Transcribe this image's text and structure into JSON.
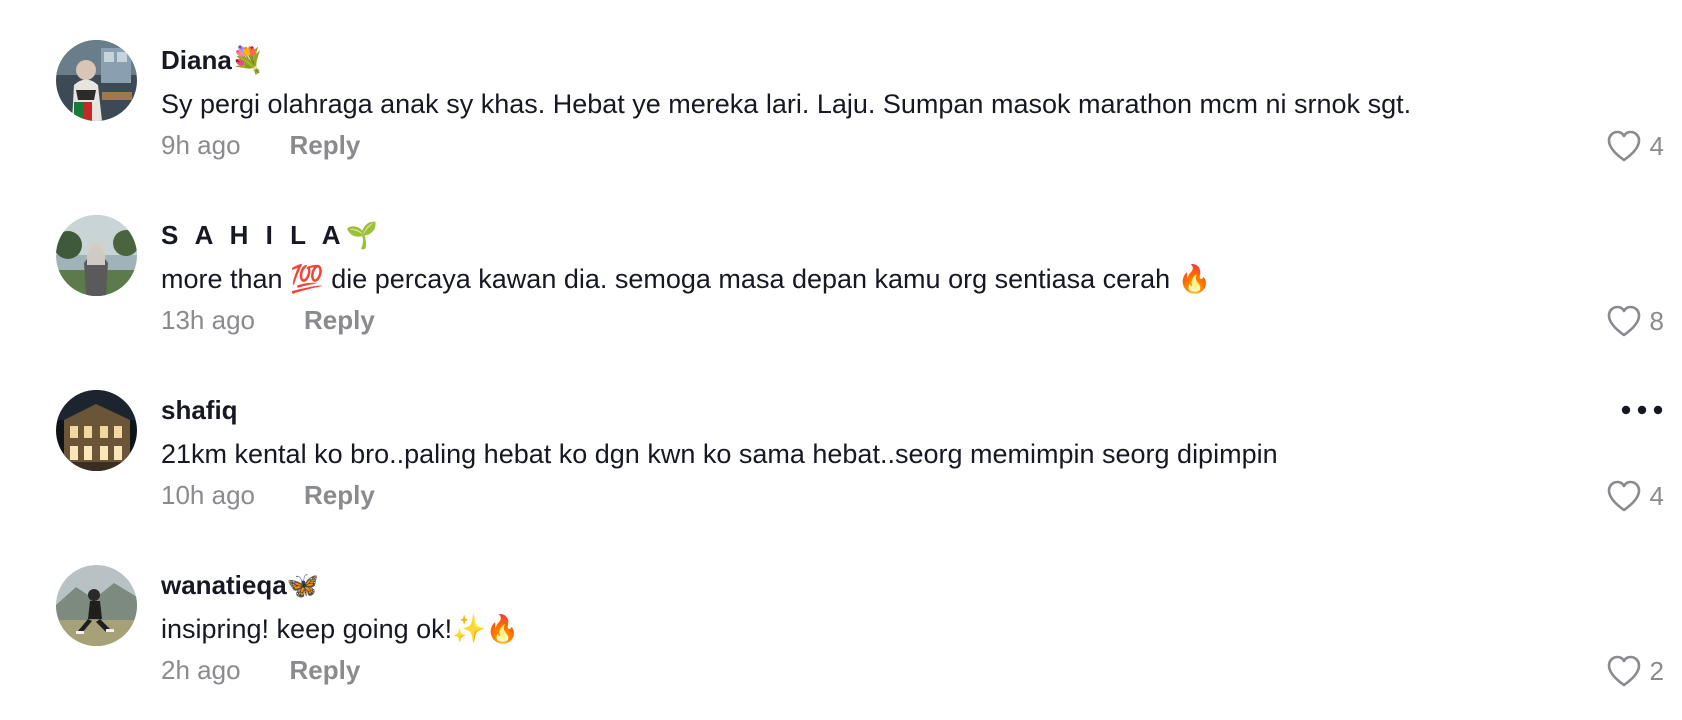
{
  "comments": [
    {
      "username": "Diana",
      "username_emoji": "💐",
      "text": "Sy pergi olahraga anak sy khas. Hebat ye mereka lari. Laju. Sumpan masok marathon mcm ni srnok sgt.",
      "time": "9h ago",
      "reply_label": "Reply",
      "likes": "4"
    },
    {
      "username": "S A H I L A",
      "username_emoji": "🌱",
      "text_parts": [
        "more than ",
        "💯",
        " die percaya kawan dia. semoga masa depan kamu org sentiasa cerah ",
        "🔥"
      ],
      "time": "13h ago",
      "reply_label": "Reply",
      "likes": "8"
    },
    {
      "username": "shafiq",
      "username_emoji": "",
      "text": "21km kental ko bro..paling hebat ko dgn kwn ko sama hebat..seorg memimpin seorg dipimpin",
      "time": "10h ago",
      "reply_label": "Reply",
      "likes": "4",
      "has_more_menu": true
    },
    {
      "username": "wanatieqa",
      "username_emoji": "🦋",
      "text_parts": [
        "insipring! keep going ok!",
        "✨🔥"
      ],
      "time": "2h ago",
      "reply_label": "Reply",
      "likes": "2"
    }
  ],
  "colors": {
    "text": "#161823",
    "muted": "#8a8b91",
    "background": "#ffffff"
  },
  "icons": {
    "like": "heart-outline-icon",
    "more": "more-dots-icon"
  }
}
